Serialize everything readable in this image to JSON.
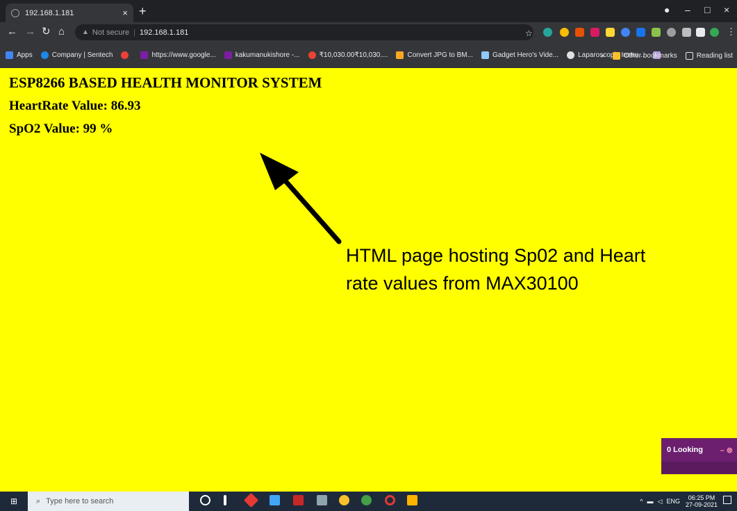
{
  "browser": {
    "tab_title": "192.168.1.181",
    "tab_close": "×",
    "new_tab": "+",
    "not_secure_label": "Not secure",
    "url": "192.168.1.181",
    "bookmarks": [
      {
        "label": "Apps",
        "color": "#4285f4"
      },
      {
        "label": "Company | Sentech",
        "color": "#1e88e5"
      },
      {
        "label": "",
        "color": "#ea4335"
      },
      {
        "label": "https://www.google...",
        "color": "#7b1fa2"
      },
      {
        "label": "kakumanukishore -...",
        "color": "#7b1fa2"
      },
      {
        "label": "₹10,030.00₹10,030....",
        "color": "#ea4335"
      },
      {
        "label": "Convert JPG to BM...",
        "color": "#f9a825"
      },
      {
        "label": "Gadget Hero's Vide...",
        "color": "#90caf9"
      },
      {
        "label": "Laparoscopic Instru...",
        "color": "#e0e0e0"
      }
    ],
    "overflow": "»",
    "other_bookmarks": "Other bookmarks",
    "reading_list": "Reading list"
  },
  "page": {
    "heading": "ESP8266 BASED HEALTH MONITOR SYSTEM",
    "heart_rate": "HeartRate Value: 86.93",
    "spo2": "SpO2 Value: 99 %",
    "annotation": "HTML page hosting Sp02 and Heart rate values from MAX30100"
  },
  "widget": {
    "looking_label": "0 Looking",
    "controls": "– ⊗"
  },
  "taskbar": {
    "search_placeholder": "Type here to search",
    "lang": "ENG",
    "time": "06:25 PM",
    "date": "27-09-2021"
  },
  "colors": {
    "page_background": "#ffff00",
    "browser_chrome": "#35363a"
  }
}
